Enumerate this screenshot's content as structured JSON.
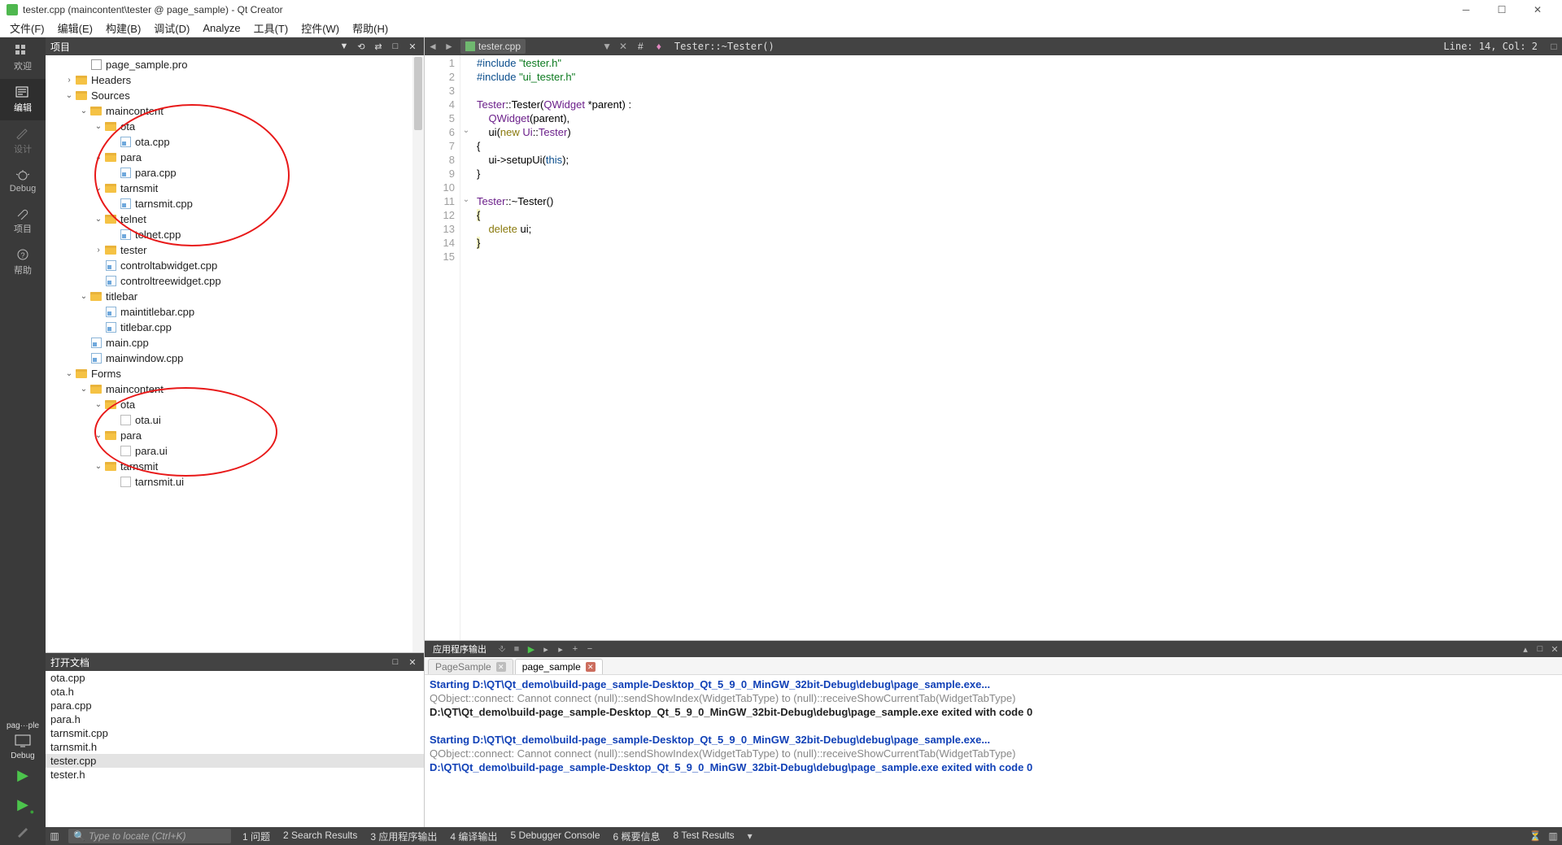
{
  "window": {
    "title": "tester.cpp (maincontent\\tester @ page_sample) - Qt Creator"
  },
  "menu": [
    "文件(F)",
    "编辑(E)",
    "构建(B)",
    "调试(D)",
    "Analyze",
    "工具(T)",
    "控件(W)",
    "帮助(H)"
  ],
  "activity": {
    "items": [
      {
        "label": "欢迎"
      },
      {
        "label": "编辑"
      },
      {
        "label": "设计"
      },
      {
        "label": "Debug"
      },
      {
        "label": "项目"
      },
      {
        "label": "帮助"
      }
    ],
    "project_selector": "pag···ple",
    "debug_label": "Debug"
  },
  "project_pane": {
    "title": "项目",
    "tree": [
      {
        "depth": 1,
        "expander": "",
        "icon": "pro",
        "label": "page_sample.pro"
      },
      {
        "depth": 0,
        "expander": ">",
        "icon": "folder",
        "label": "Headers"
      },
      {
        "depth": 0,
        "expander": "v",
        "icon": "folder",
        "label": "Sources"
      },
      {
        "depth": 1,
        "expander": "v",
        "icon": "folder",
        "label": "maincontent"
      },
      {
        "depth": 2,
        "expander": "v",
        "icon": "folder",
        "label": "ota"
      },
      {
        "depth": 3,
        "expander": "",
        "icon": "cpp",
        "label": "ota.cpp"
      },
      {
        "depth": 2,
        "expander": "v",
        "icon": "folder",
        "label": "para"
      },
      {
        "depth": 3,
        "expander": "",
        "icon": "cpp",
        "label": "para.cpp"
      },
      {
        "depth": 2,
        "expander": "v",
        "icon": "folder",
        "label": "tarnsmit"
      },
      {
        "depth": 3,
        "expander": "",
        "icon": "cpp",
        "label": "tarnsmit.cpp"
      },
      {
        "depth": 2,
        "expander": "v",
        "icon": "folder",
        "label": "telnet"
      },
      {
        "depth": 3,
        "expander": "",
        "icon": "cpp",
        "label": "telnet.cpp"
      },
      {
        "depth": 2,
        "expander": ">",
        "icon": "folder",
        "label": "tester"
      },
      {
        "depth": 2,
        "expander": "",
        "icon": "cpp",
        "label": "controltabwidget.cpp"
      },
      {
        "depth": 2,
        "expander": "",
        "icon": "cpp",
        "label": "controltreewidget.cpp"
      },
      {
        "depth": 1,
        "expander": "v",
        "icon": "folder",
        "label": "titlebar"
      },
      {
        "depth": 2,
        "expander": "",
        "icon": "cpp",
        "label": "maintitlebar.cpp"
      },
      {
        "depth": 2,
        "expander": "",
        "icon": "cpp",
        "label": "titlebar.cpp"
      },
      {
        "depth": 1,
        "expander": "",
        "icon": "cpp",
        "label": "main.cpp"
      },
      {
        "depth": 1,
        "expander": "",
        "icon": "cpp",
        "label": "mainwindow.cpp"
      },
      {
        "depth": 0,
        "expander": "v",
        "icon": "folder",
        "label": "Forms"
      },
      {
        "depth": 1,
        "expander": "v",
        "icon": "folder",
        "label": "maincontent"
      },
      {
        "depth": 2,
        "expander": "v",
        "icon": "folder",
        "label": "ota"
      },
      {
        "depth": 3,
        "expander": "",
        "icon": "ui",
        "label": "ota.ui"
      },
      {
        "depth": 2,
        "expander": "v",
        "icon": "folder",
        "label": "para"
      },
      {
        "depth": 3,
        "expander": "",
        "icon": "ui",
        "label": "para.ui"
      },
      {
        "depth": 2,
        "expander": "v",
        "icon": "folder",
        "label": "tarnsmit"
      },
      {
        "depth": 3,
        "expander": "",
        "icon": "ui",
        "label": "tarnsmit.ui"
      }
    ]
  },
  "open_docs": {
    "title": "打开文档",
    "items": [
      "ota.cpp",
      "ota.h",
      "para.cpp",
      "para.h",
      "tarnsmit.cpp",
      "tarnsmit.h",
      "tester.cpp",
      "tester.h"
    ],
    "selected": "tester.cpp"
  },
  "editor": {
    "filename": "tester.cpp",
    "breadcrumb_symbol": "Tester::~Tester()",
    "linecol": "Line: 14, Col: 2",
    "lines": [
      {
        "n": 1,
        "html": "<span class='kw-prep'>#include</span> <span class='kw-str'>\"tester.h\"</span>"
      },
      {
        "n": 2,
        "html": "<span class='kw-prep'>#include</span> <span class='kw-str'>\"ui_tester.h\"</span>"
      },
      {
        "n": 3,
        "html": ""
      },
      {
        "n": 4,
        "html": "<span class='kw-type'>Tester</span>::<span>Tester</span>(<span class='kw-type'>QWidget</span> *parent) :"
      },
      {
        "n": 5,
        "html": "    <span class='kw-type'>QWidget</span>(parent),"
      },
      {
        "n": 6,
        "html": "    <span>ui</span>(<span class='kw-kw'>new</span> <span class='kw-type'>Ui</span>::<span class='kw-type'>Tester</span>)",
        "fold": "v"
      },
      {
        "n": 7,
        "html": "{"
      },
      {
        "n": 8,
        "html": "    ui-&gt;setupUi(<span class='kw-this'>this</span>);"
      },
      {
        "n": 9,
        "html": "}"
      },
      {
        "n": 10,
        "html": ""
      },
      {
        "n": 11,
        "html": "<span class='kw-type'>Tester</span>::~<span>Tester</span>()",
        "fold": "v"
      },
      {
        "n": 12,
        "html": "<span class='cur-line-hl'>{</span>"
      },
      {
        "n": 13,
        "html": "    <span class='kw-kw'>delete</span> ui;"
      },
      {
        "n": 14,
        "html": "<span class='cur-line-hl'>}</span>"
      },
      {
        "n": 15,
        "html": ""
      }
    ]
  },
  "output": {
    "title": "应用程序输出",
    "tabs": [
      {
        "label": "PageSample",
        "active": false,
        "close": "gray"
      },
      {
        "label": "page_sample",
        "active": true,
        "close": "red"
      }
    ],
    "lines": [
      {
        "cls": "out-blue",
        "text": "Starting D:\\QT\\Qt_demo\\build-page_sample-Desktop_Qt_5_9_0_MinGW_32bit-Debug\\debug\\page_sample.exe..."
      },
      {
        "cls": "out-gray",
        "text": "QObject::connect: Cannot connect (null)::sendShowIndex(WidgetTabType) to (null)::receiveShowCurrentTab(WidgetTabType)"
      },
      {
        "cls": "out-black",
        "text": "D:\\QT\\Qt_demo\\build-page_sample-Desktop_Qt_5_9_0_MinGW_32bit-Debug\\debug\\page_sample.exe exited with code 0"
      },
      {
        "cls": "",
        "text": ""
      },
      {
        "cls": "out-blue",
        "text": "Starting D:\\QT\\Qt_demo\\build-page_sample-Desktop_Qt_5_9_0_MinGW_32bit-Debug\\debug\\page_sample.exe..."
      },
      {
        "cls": "out-gray",
        "text": "QObject::connect: Cannot connect (null)::sendShowIndex(WidgetTabType) to (null)::receiveShowCurrentTab(WidgetTabType)"
      },
      {
        "cls": "out-blue",
        "text": "D:\\QT\\Qt_demo\\build-page_sample-Desktop_Qt_5_9_0_MinGW_32bit-Debug\\debug\\page_sample.exe exited with code 0"
      }
    ]
  },
  "status": {
    "locator_placeholder": "Type to locate (Ctrl+K)",
    "items": [
      "1 问题",
      "2 Search Results",
      "3 应用程序输出",
      "4 编译输出",
      "5 Debugger Console",
      "6 概要信息",
      "8 Test Results"
    ]
  }
}
